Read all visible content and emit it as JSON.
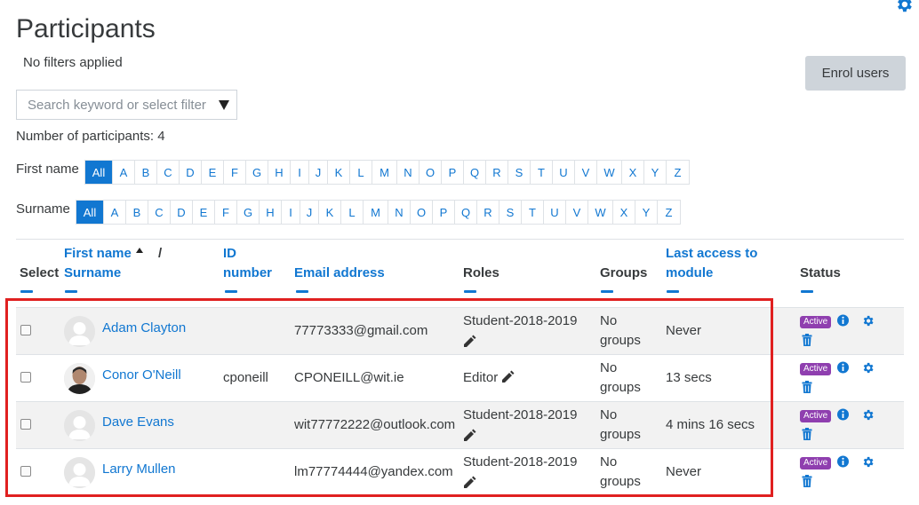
{
  "page": {
    "title": "Participants",
    "filters_status": "No filters applied"
  },
  "actions": {
    "enrol_label": "Enrol users"
  },
  "search": {
    "placeholder": "Search keyword or select filter"
  },
  "participants_count": "Number of participants: 4",
  "firstname_bar": {
    "label": "First name"
  },
  "surname_bar": {
    "label": "Surname"
  },
  "letters": [
    "All",
    "A",
    "B",
    "C",
    "D",
    "E",
    "F",
    "G",
    "H",
    "I",
    "J",
    "K",
    "L",
    "M",
    "N",
    "O",
    "P",
    "Q",
    "R",
    "S",
    "T",
    "U",
    "V",
    "W",
    "X",
    "Y",
    "Z"
  ],
  "table": {
    "headers": {
      "select": "Select",
      "firstname": "First name",
      "sort_separator": "/",
      "surname": "Surname",
      "id_number_1": "ID",
      "id_number_2": "number",
      "email": "Email address",
      "roles": "Roles",
      "groups": "Groups",
      "last_access_1": "Last access to",
      "last_access_2": "module",
      "status": "Status"
    },
    "rows": [
      {
        "name": "Adam Clayton",
        "id_number": "",
        "email": "77773333@gmail.com",
        "role": "Student-2018-2019",
        "groups_1": "No",
        "groups_2": "groups",
        "last_access": "Never",
        "status": "Active"
      },
      {
        "name": "Conor O'Neill",
        "id_number": "cponeill",
        "email": "CPONEILL@wit.ie",
        "role": "Editor",
        "groups_1": "No",
        "groups_2": "groups",
        "last_access": "13 secs",
        "status": "Active"
      },
      {
        "name": "Dave Evans",
        "id_number": "",
        "email": "wit77772222@outlook.com",
        "role": "Student-2018-2019",
        "groups_1": "No",
        "groups_2": "groups",
        "last_access": "4 mins 16 secs",
        "status": "Active"
      },
      {
        "name": "Larry Mullen",
        "id_number": "",
        "email": "lm77774444@yandex.com",
        "role": "Student-2018-2019",
        "groups_1": "No",
        "groups_2": "groups",
        "last_access": "Never",
        "status": "Active"
      }
    ]
  },
  "colors": {
    "link": "#1177d1",
    "active_badge": "#8f3faf",
    "highlight_box": "#e02020"
  }
}
